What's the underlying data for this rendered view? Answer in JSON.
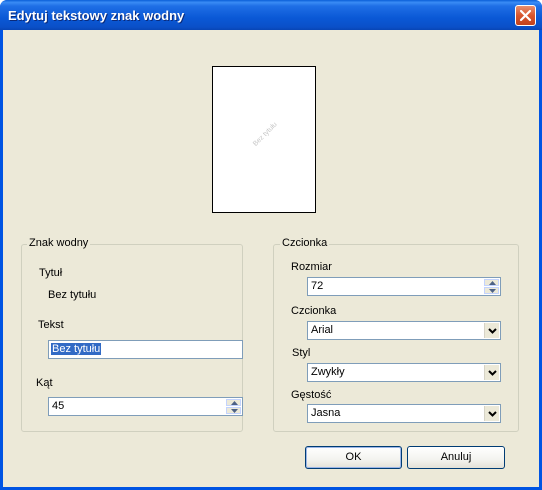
{
  "window": {
    "title": "Edytuj tekstowy znak wodny"
  },
  "preview": {
    "watermark_text": "Bez tytułu"
  },
  "watermark_group": {
    "legend": "Znak wodny",
    "title_label": "Tytuł",
    "title_value": "Bez tytułu",
    "text_label": "Tekst",
    "text_value": "Bez tytułu",
    "angle_label": "Kąt",
    "angle_value": "45"
  },
  "font_group": {
    "legend": "Czcionka",
    "size_label": "Rozmiar",
    "size_value": "72",
    "font_label": "Czcionka",
    "font_value": "Arial",
    "style_label": "Styl",
    "style_value": "Zwykły",
    "density_label": "Gęstość",
    "density_value": "Jasna"
  },
  "buttons": {
    "ok": "OK",
    "cancel": "Anuluj"
  },
  "icons": {
    "close": "close-icon",
    "spin_up": "spin-up-icon",
    "spin_down": "spin-down-icon",
    "dropdown": "chevron-down-icon"
  },
  "colors": {
    "titlebar": "#0a58d6",
    "dialog_bg": "#ece9d8",
    "selection": "#316ac5",
    "close_button": "#d8552e"
  }
}
